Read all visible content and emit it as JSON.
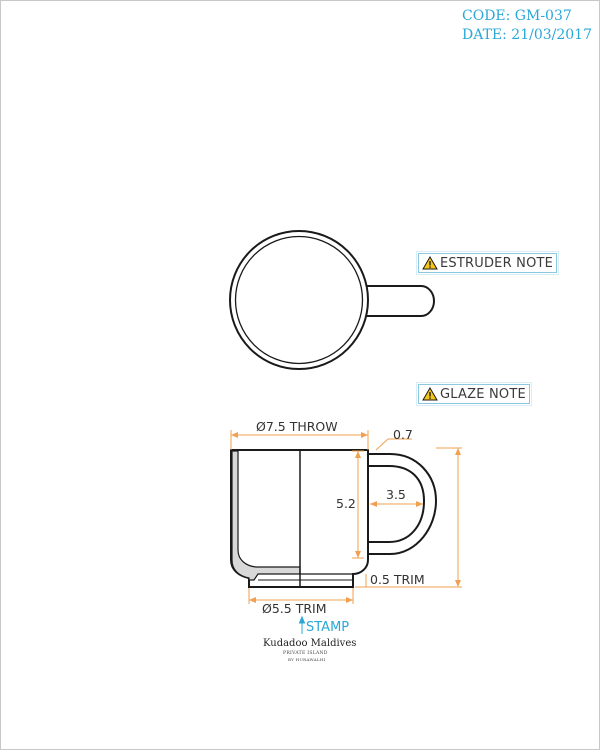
{
  "header": {
    "code": "CODE: GM-037",
    "date": "DATE: 21/03/2017"
  },
  "notes": {
    "extruder": "ESTRUDER NOTE",
    "glaze": "GLAZE NOTE"
  },
  "dimensions": {
    "throw_diameter": "Ø7.5 THROW",
    "handle_thickness": "0.7",
    "height": "5.2",
    "handle_width": "3.5",
    "bottom_trim": "0.5 TRIM",
    "base_trim_diameter": "Ø5.5 TRIM"
  },
  "stamp": {
    "label": "STAMP",
    "logo_title": "Kudadoo Maldives",
    "logo_subtitle": "PRIVATE ISLAND",
    "logo_tagline": "BY HURAWALHI"
  },
  "colors": {
    "outline": "#1a1a1a",
    "dimension": "#f0a050",
    "accent": "#2aa8d8",
    "section_fill": "#d8d8d8"
  }
}
